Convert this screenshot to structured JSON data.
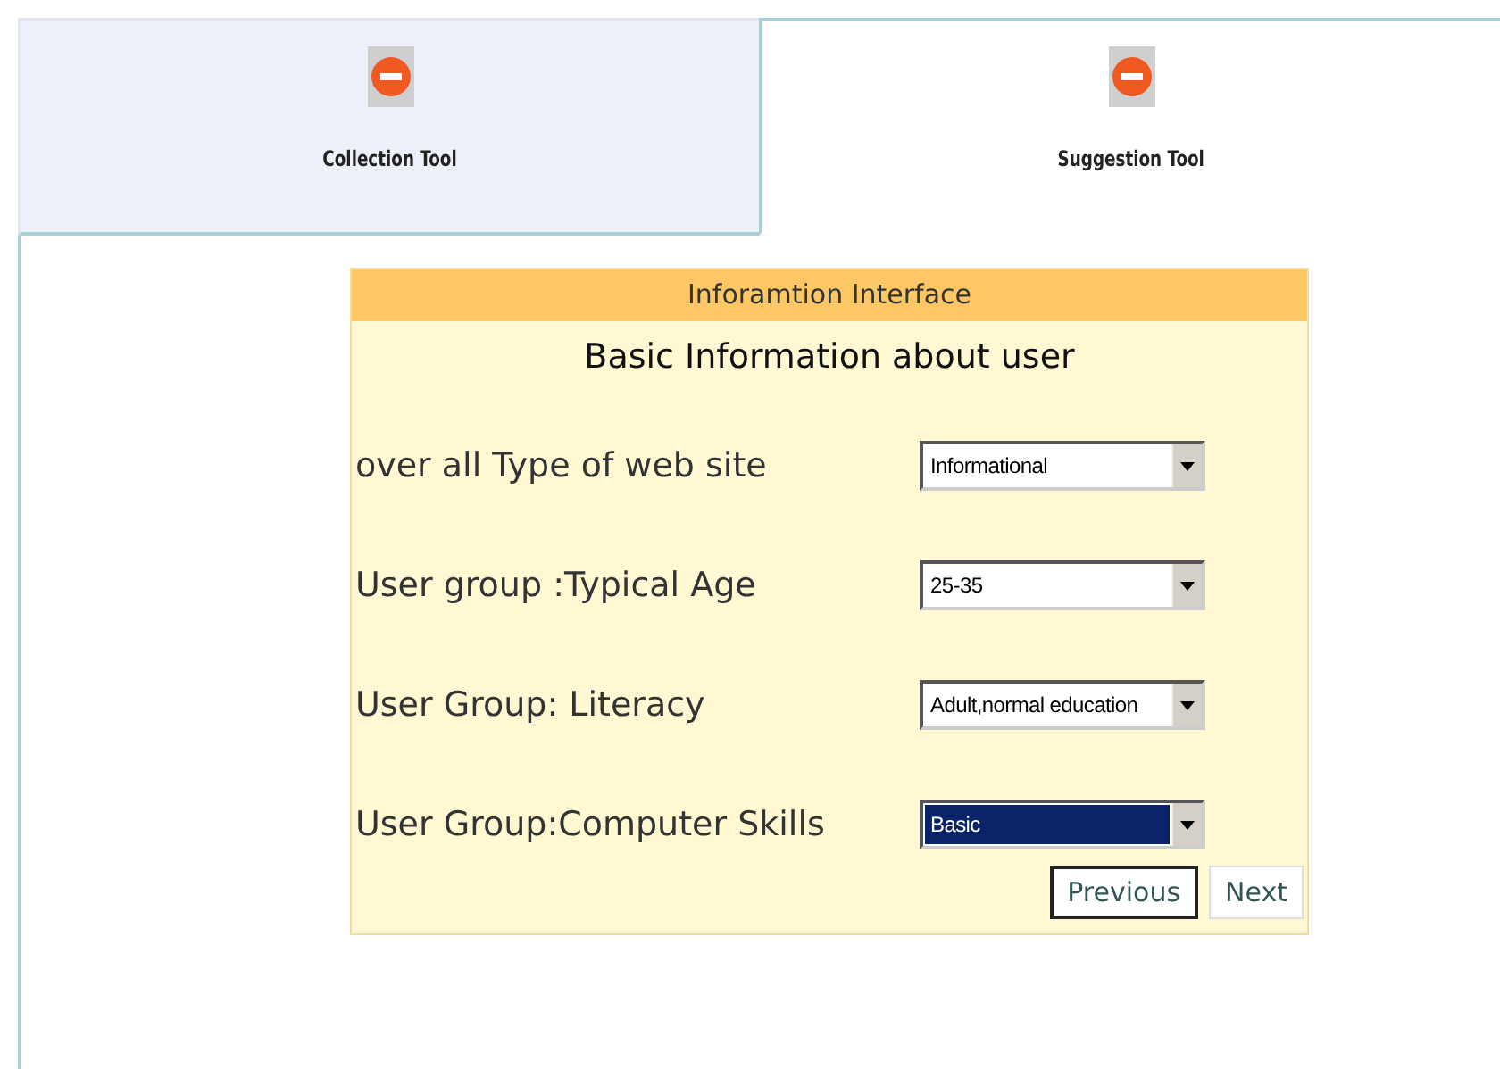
{
  "tabs": [
    {
      "label": "Collection Tool",
      "selected": false
    },
    {
      "label": "Suggestion Tool",
      "selected": true
    }
  ],
  "form": {
    "header": "Inforamtion Interface",
    "heading": "Basic Information about user",
    "fields": [
      {
        "label": "over all Type of web site",
        "value": "Informational",
        "focused": false
      },
      {
        "label": "User group :Typical Age",
        "value": "25-35",
        "focused": false
      },
      {
        "label": "User Group: Literacy",
        "value": "Adult,normal education",
        "focused": false
      },
      {
        "label": "User Group:Computer Skills",
        "value": "Basic",
        "focused": true
      }
    ],
    "buttons": [
      {
        "label": "Previous",
        "focused": true
      },
      {
        "label": "Next",
        "focused": false
      }
    ]
  }
}
